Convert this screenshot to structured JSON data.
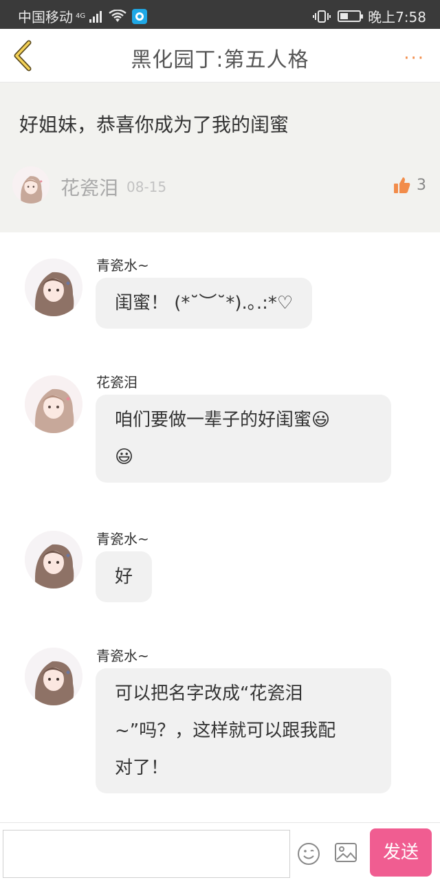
{
  "status_bar": {
    "carrier": "中国移动",
    "network": "4G",
    "time": "晚上7:58"
  },
  "header": {
    "title": "黑化园丁:第五人格",
    "more_label": "···"
  },
  "post": {
    "text": "好姐妹，恭喜你成为了我的闺蜜",
    "author": "花瓷泪",
    "date": "08-15",
    "likes": "3"
  },
  "messages": [
    {
      "name": "青瓷水~",
      "lines": [
        "闺蜜！ (*˘︶˘*).｡.:*♡"
      ]
    },
    {
      "name": "花瓷泪",
      "lines": [
        "咱们要做一辈子的好闺蜜😃",
        "😃"
      ]
    },
    {
      "name": "青瓷水~",
      "lines": [
        "好"
      ]
    },
    {
      "name": "青瓷水~",
      "lines": [
        "可以把名字改成“花瓷泪",
        "~”吗？，这样就可以跟我配",
        "对了！"
      ]
    }
  ],
  "input": {
    "placeholder": "",
    "send_label": "发送"
  },
  "colors": {
    "accent": "#f28c4a",
    "send_button": "#f05d91",
    "post_background": "#f2f2ef",
    "bubble": "#f1f1f1"
  }
}
